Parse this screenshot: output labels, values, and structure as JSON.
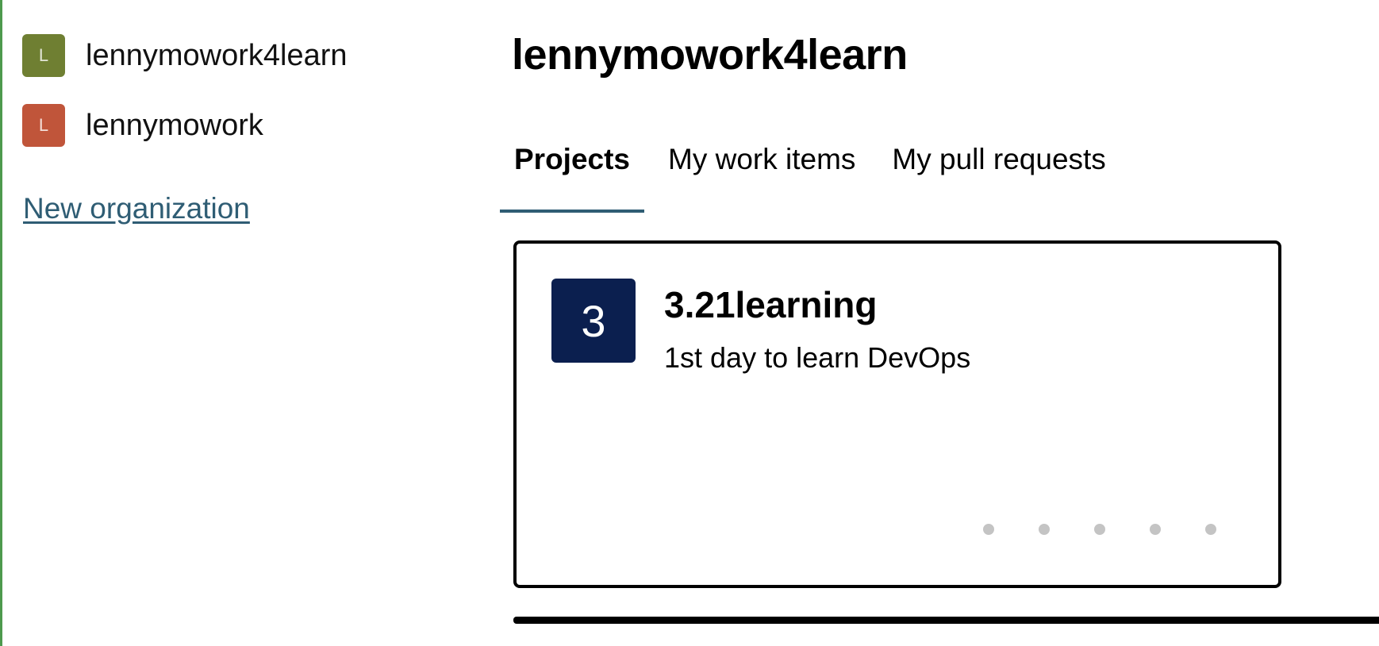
{
  "sidebar": {
    "organizations": [
      {
        "initial": "L",
        "name": "lennymowork4learn",
        "color": "#6f7f32"
      },
      {
        "initial": "L",
        "name": "lennymowork",
        "color": "#c0553a"
      }
    ],
    "new_org_label": "New organization"
  },
  "main": {
    "title": "lennymowork4learn",
    "tabs": [
      {
        "label": "Projects",
        "active": true
      },
      {
        "label": "My work items",
        "active": false
      },
      {
        "label": "My pull requests",
        "active": false
      }
    ],
    "projects": [
      {
        "initial": "3",
        "name": "3.21learning",
        "description": "1st day to learn DevOps",
        "color": "#0b1f4f"
      }
    ]
  },
  "colors": {
    "accent": "#2f5d74",
    "left_border": "#4e9a4e"
  }
}
